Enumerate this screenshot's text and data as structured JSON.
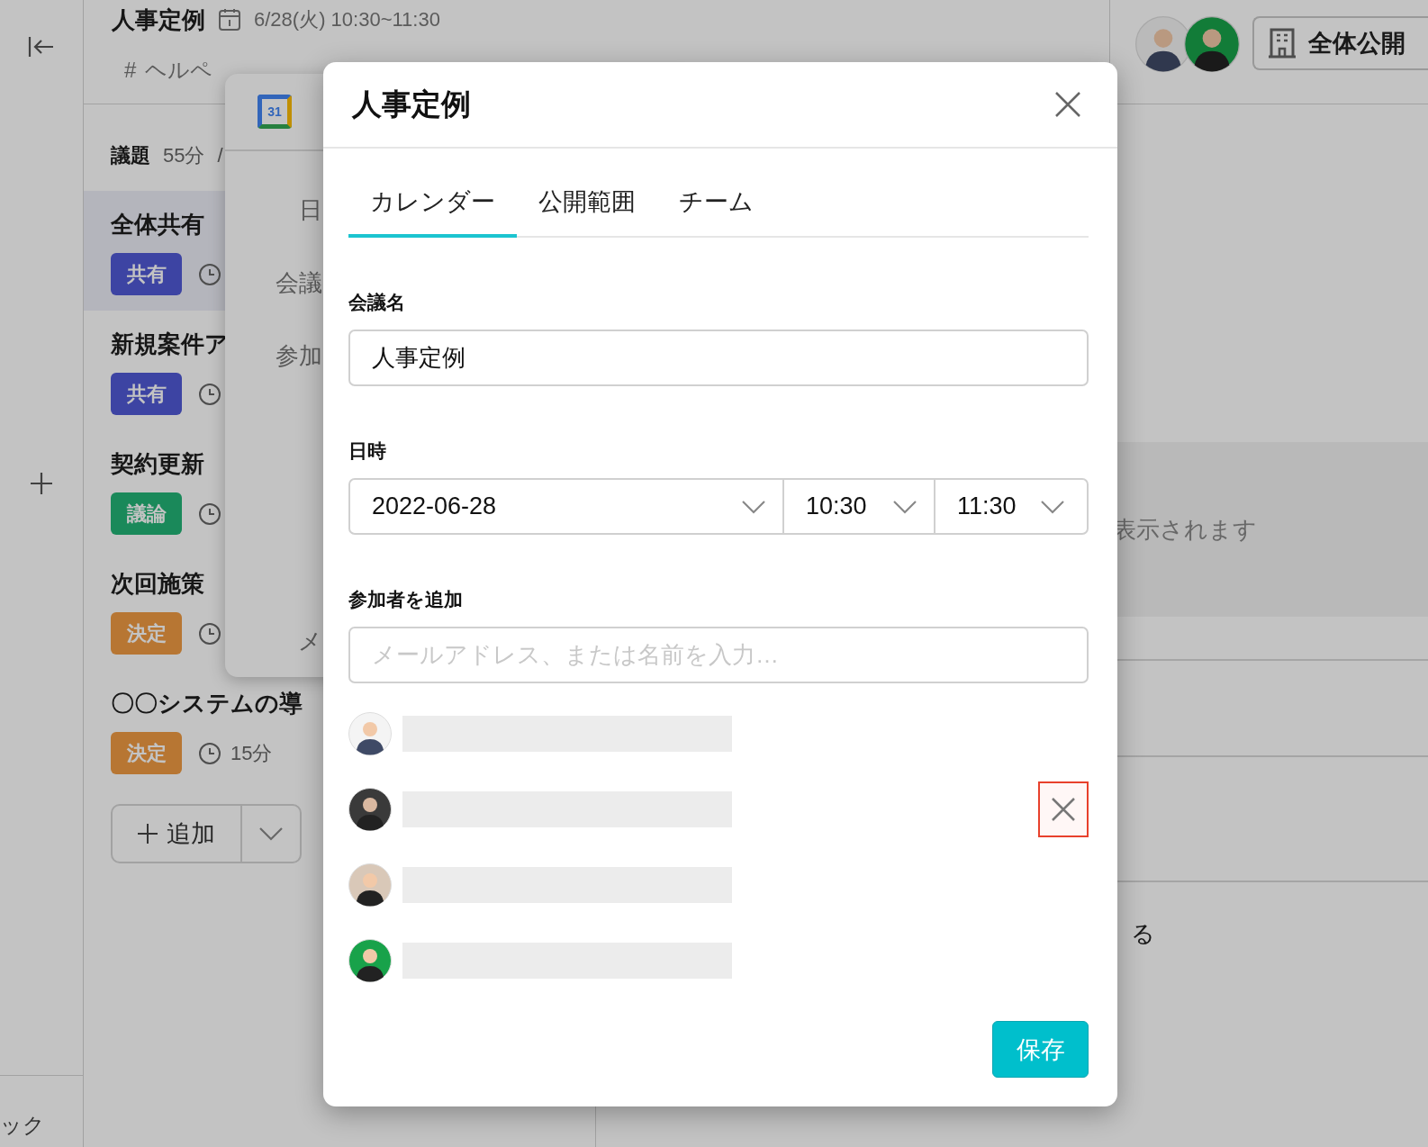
{
  "sidebar": {
    "bottom_text": "ック"
  },
  "header": {
    "title": "人事定例",
    "datetime": "6/28(火) 10:30~11:30",
    "channel_mark": "#",
    "channel": "ヘルペ"
  },
  "visibility_button": {
    "label": "全体公開"
  },
  "agenda": {
    "label": "議題",
    "duration": "55分",
    "separator": "/",
    "items": [
      {
        "title": "全体共有",
        "tag": "共有",
        "kind": "share",
        "selected": true
      },
      {
        "title": "新規案件ア",
        "tag": "共有",
        "kind": "share",
        "selected": false
      },
      {
        "title": "契約更新",
        "tag": "議論",
        "kind": "discuss",
        "selected": false
      },
      {
        "title": "次回施策",
        "tag": "決定",
        "kind": "decide",
        "selected": false
      },
      {
        "title": "〇〇システムの導",
        "tag": "決定",
        "kind": "decide",
        "selected": false,
        "time": "15分"
      }
    ],
    "add_button": "追加"
  },
  "right_panel": {
    "notice": "表示されます",
    "fragment": "る"
  },
  "event_card": {
    "logo_text": "31",
    "labels": [
      "日",
      "会議",
      "参加",
      "メ"
    ]
  },
  "dialog": {
    "title": "人事定例",
    "tabs": [
      {
        "label": "カレンダー",
        "selected": true
      },
      {
        "label": "公開範囲",
        "selected": false
      },
      {
        "label": "チーム",
        "selected": false
      }
    ],
    "meeting_name": {
      "label": "会議名",
      "value": "人事定例"
    },
    "datetime": {
      "label": "日時",
      "date": "2022-06-28",
      "start": "10:30",
      "end": "11:30"
    },
    "participants": {
      "label": "参加者を追加",
      "placeholder": "メールアドレス、または名前を入力…",
      "items": [
        {
          "removable": false,
          "highlighted": false
        },
        {
          "removable": true,
          "highlighted": true
        },
        {
          "removable": false,
          "highlighted": false
        },
        {
          "removable": false,
          "highlighted": false
        }
      ]
    },
    "save_button": "保存"
  }
}
